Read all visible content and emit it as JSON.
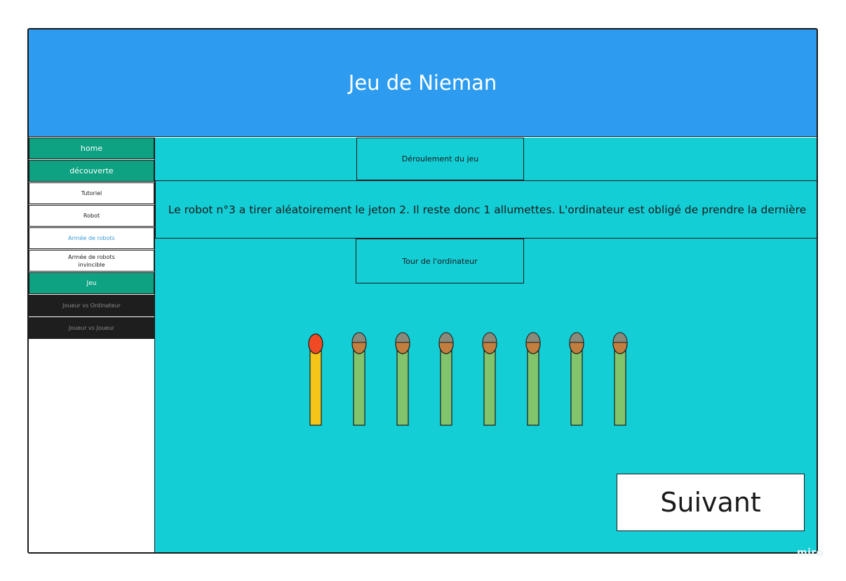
{
  "header": {
    "title": "Jeu de Nieman"
  },
  "sidebar": {
    "items": [
      {
        "label": "home",
        "style": "green"
      },
      {
        "label": "découverte",
        "style": "green"
      },
      {
        "label": "Tutoriel",
        "style": "white"
      },
      {
        "label": "Robot",
        "style": "white"
      },
      {
        "label": "Armée de robots",
        "style": "link"
      },
      {
        "label": "Armée de robots invincible",
        "style": "white"
      },
      {
        "label": "Jeu",
        "style": "green"
      },
      {
        "label": "Joueur vs Ordinateur",
        "style": "dark"
      },
      {
        "label": "Joueur vs Joueur",
        "style": "dark"
      }
    ]
  },
  "main": {
    "section_title": "Déroulement du jeu",
    "message": "Le robot n°3 a tirer aléatoirement le jeton 2. Il reste donc 1 allumettes. L'ordinateur est obligé de prendre la dernière",
    "turn_label": "Tour de l'ordinateur",
    "next_label": "Suivant"
  },
  "matches": {
    "count": 8,
    "highlighted_index": 0,
    "colors": {
      "highlight_stick": "#f5c518",
      "highlight_head": "#f04a24",
      "stick": "#82c46c",
      "head_top": "#8a8a7a",
      "head_bottom": "#c27e3e"
    }
  },
  "watermark": "miro"
}
